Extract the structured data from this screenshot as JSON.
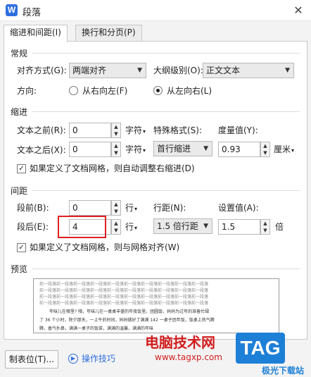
{
  "window": {
    "app_icon": "W",
    "title": "段落",
    "close": "✕"
  },
  "tabs": [
    {
      "label": "缩进和间距(I)",
      "active": true
    },
    {
      "label": "换行和分页(P)",
      "active": false
    }
  ],
  "general": {
    "heading": "常规",
    "align_label": "对齐方式(G):",
    "align_value": "两端对齐",
    "outline_label": "大纲级别(O):",
    "outline_value": "正文文本",
    "direction_label": "方向:",
    "rtl_label": "从右向左(F)",
    "ltr_label": "从左向右(L)"
  },
  "indent": {
    "heading": "缩进",
    "before_label": "文本之前(R):",
    "before_value": "0",
    "before_unit": "字符",
    "after_label": "文本之后(X):",
    "after_value": "0",
    "after_unit": "字符",
    "special_label": "特殊格式(S):",
    "special_value": "首行缩进",
    "measure_label": "度量值(Y):",
    "measure_value": "0.93",
    "measure_unit": "厘米",
    "grid_check_label": "如果定义了文档网格，则自动调整右缩进(D)"
  },
  "spacing": {
    "heading": "间距",
    "before_label": "段前(B):",
    "before_value": "0",
    "before_unit": "行",
    "after_label": "段后(E):",
    "after_value": "4",
    "after_unit": "行",
    "line_label": "行距(N):",
    "line_value": "1.5 倍行距",
    "setting_label": "设置值(A):",
    "setting_value": "1.5",
    "setting_unit": "倍",
    "grid_check_label": "如果定义了文档网格，则与网格对齐(W)"
  },
  "preview": {
    "heading": "预览",
    "prev_line": "前一段落前一段落前一段落前一段落前一段落前一段落前一段落前一段落前一段落前一段落",
    "body_1": "年味儿在哪里? 哦，年味儿在一桌桌丰盛的年夜饭里。团圆饭，妈妈为过年的准备忙碌",
    "body_2": "了 36 个小时，除夕那天，一上午的时间，妈妈做好了满满 142 一桌子团年饭，饭桌上热气腾",
    "body_3": "腾，香气扑鼻，满满一桌子的饭菜，满满的温馨，满满的年味"
  },
  "footer": {
    "tabs_button": "制表位(T)...",
    "tips_label": "操作技巧"
  },
  "watermark": {
    "site_name": "电脑技术网",
    "url": "www.tagxp.com",
    "tag": "TAG",
    "tag_sub": "极光下载站"
  }
}
